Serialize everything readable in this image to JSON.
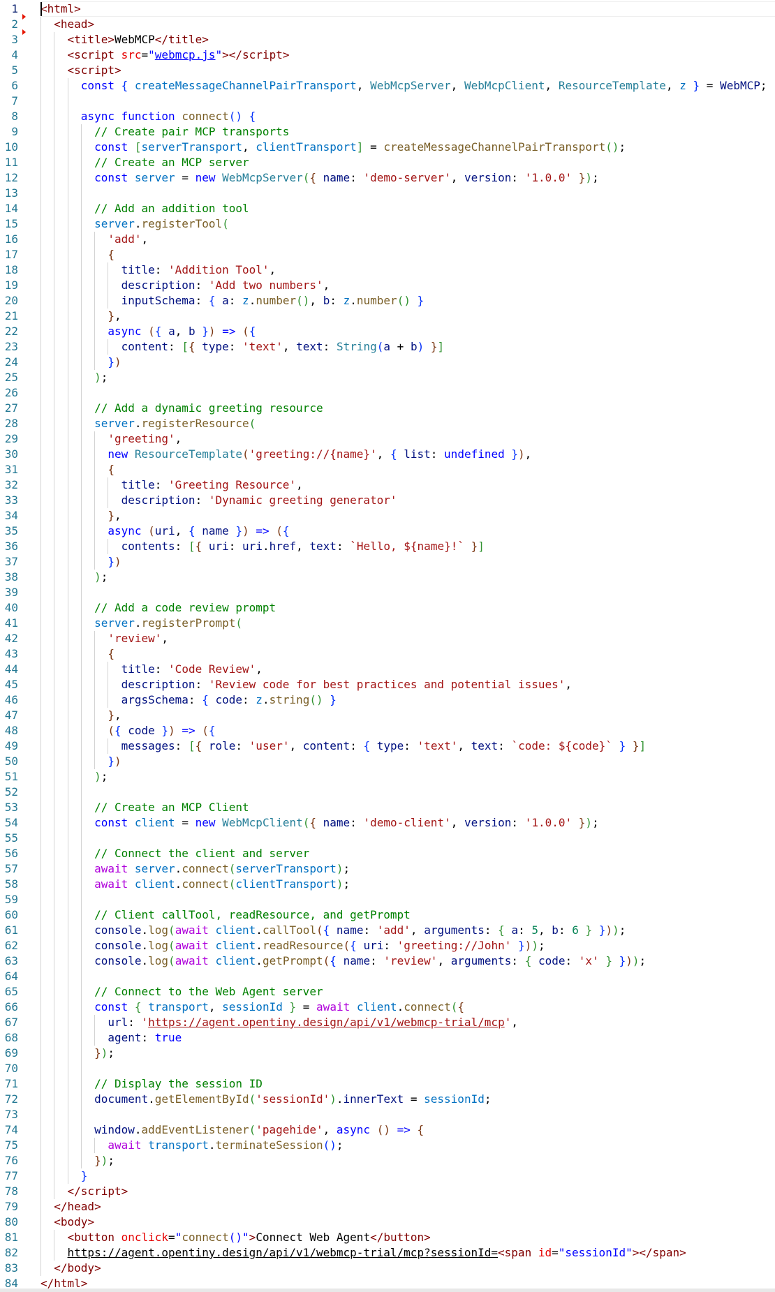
{
  "editor": {
    "active_line": 1,
    "error_markers": [
      2,
      3
    ],
    "colors": {
      "keyword": "#0000ff",
      "control": "#af00db",
      "string": "#a31515",
      "comment": "#008000",
      "number": "#098658",
      "function": "#795e26",
      "type": "#267f99",
      "const_var": "#0070c1",
      "variable": "#001080",
      "tag": "#800000",
      "attr": "#e50000",
      "attr_value": "#0000ff",
      "brackets": [
        "#0431fa",
        "#319331",
        "#7b3814"
      ]
    },
    "lines": [
      "<html>",
      "  <head>",
      "    <title>WebMCP</title>",
      "    <script src=\"webmcp.js\"></script>",
      "    <script>",
      "      const { createMessageChannelPairTransport, WebMcpServer, WebMcpClient, ResourceTemplate, z } = WebMCP;",
      "",
      "      async function connect() {",
      "        // Create pair MCP transports",
      "        const [serverTransport, clientTransport] = createMessageChannelPairTransport();",
      "        // Create an MCP server",
      "        const server = new WebMcpServer({ name: 'demo-server', version: '1.0.0' });",
      "",
      "        // Add an addition tool",
      "        server.registerTool(",
      "          'add',",
      "          {",
      "            title: 'Addition Tool',",
      "            description: 'Add two numbers',",
      "            inputSchema: { a: z.number(), b: z.number() }",
      "          },",
      "          async ({ a, b }) => ({",
      "            content: [{ type: 'text', text: String(a + b) }]",
      "          })",
      "        );",
      "",
      "        // Add a dynamic greeting resource",
      "        server.registerResource(",
      "          'greeting',",
      "          new ResourceTemplate('greeting://{name}', { list: undefined }),",
      "          {",
      "            title: 'Greeting Resource',",
      "            description: 'Dynamic greeting generator'",
      "          },",
      "          async (uri, { name }) => ({",
      "            contents: [{ uri: uri.href, text: `Hello, ${name}!` }]",
      "          })",
      "        );",
      "",
      "        // Add a code review prompt",
      "        server.registerPrompt(",
      "          'review',",
      "          {",
      "            title: 'Code Review',",
      "            description: 'Review code for best practices and potential issues',",
      "            argsSchema: { code: z.string() }",
      "          },",
      "          ({ code }) => ({",
      "            messages: [{ role: 'user', content: { type: 'text', text: `code: ${code}` } }]",
      "          })",
      "        );",
      "",
      "        // Create an MCP Client",
      "        const client = new WebMcpClient({ name: 'demo-client', version: '1.0.0' });",
      "",
      "        // Connect the client and server",
      "        await server.connect(serverTransport);",
      "        await client.connect(clientTransport);",
      "",
      "        // Client callTool, readResource, and getPrompt",
      "        console.log(await client.callTool({ name: 'add', arguments: { a: 5, b: 6 } }));",
      "        console.log(await client.readResource({ uri: 'greeting://John' }));",
      "        console.log(await client.getPrompt({ name: 'review', arguments: { code: 'x' } }));",
      "",
      "        // Connect to the Web Agent server",
      "        const { transport, sessionId } = await client.connect({",
      "          url: 'https://agent.opentiny.design/api/v1/webmcp-trial/mcp',",
      "          agent: true",
      "        });",
      "",
      "        // Display the session ID",
      "        document.getElementById('sessionId').innerText = sessionId;",
      "",
      "        window.addEventListener('pagehide', async () => {",
      "          await transport.terminateSession();",
      "        });",
      "      }",
      "    </script>",
      "  </head>",
      "  <body>",
      "    <button onclick=\"connect()\">Connect Web Agent</button>",
      "    https://agent.opentiny.design/api/v1/webmcp-trial/mcp?sessionId=<span id=\"sessionId\"></span>",
      "  </body>",
      "</html>"
    ]
  }
}
